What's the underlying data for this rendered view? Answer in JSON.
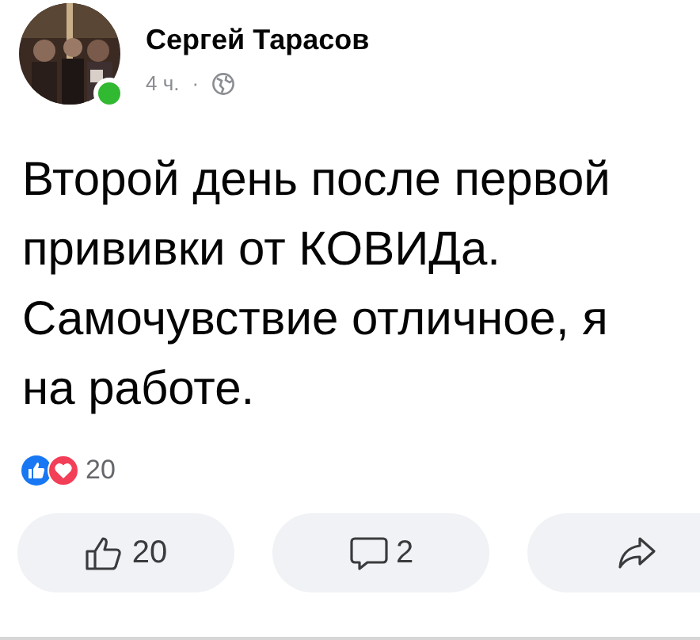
{
  "author": {
    "name": "Сергей Тарасов",
    "online": true
  },
  "time": "4 ч.",
  "separator": "·",
  "post_text": "Второй день после первой  прививки от КОВИДа. Самочувствие отличное, я на работе.",
  "reactions": {
    "count": "20"
  },
  "actions": [
    {
      "kind": "like",
      "count": "20"
    },
    {
      "kind": "comment",
      "count": "2"
    },
    {
      "kind": "share"
    }
  ]
}
